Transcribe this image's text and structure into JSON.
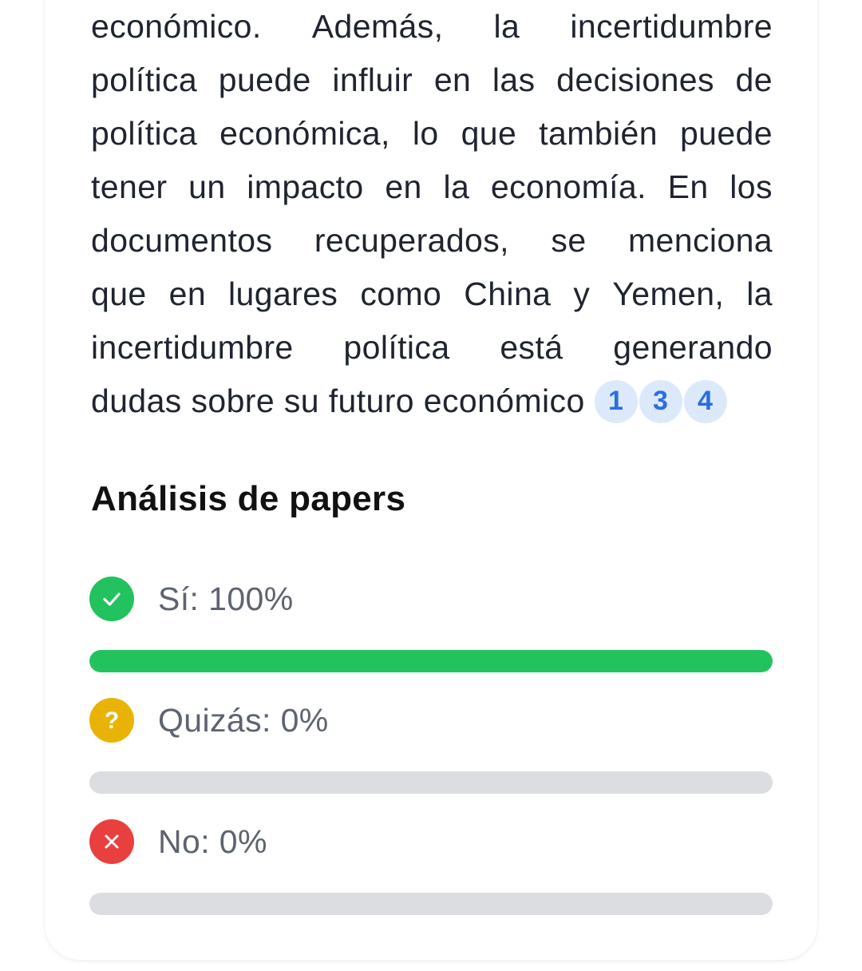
{
  "answer_text": {
    "lines": [
      "económico. Además, la incertidumbre",
      "política puede influir en las decisiones de",
      "política económica, lo que también puede",
      "tener un impacto en la economía. En los",
      "documentos recuperados, se menciona",
      "que en lugares como China y Yemen, la",
      "incertidumbre política está generando"
    ],
    "last_line": "dudas sobre su futuro económico",
    "citations": [
      "1",
      "3",
      "4"
    ]
  },
  "analysis": {
    "title": "Análisis de papers",
    "answers": [
      {
        "label": "Sí: 100%",
        "icon": "check-icon",
        "color": "#22c35e",
        "fraction": 1.0
      },
      {
        "label": "Quizás: 0%",
        "icon": "question-icon",
        "color": "#e9b306",
        "fraction": 0.0
      },
      {
        "label": "No: 0%",
        "icon": "close-icon",
        "color": "#ea3f3f",
        "fraction": 0.0
      }
    ],
    "track_color": "#dcdde1"
  }
}
